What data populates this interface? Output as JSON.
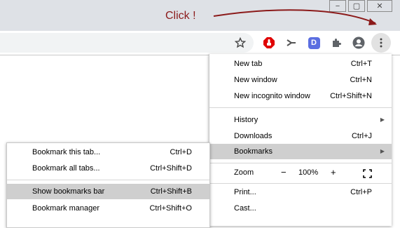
{
  "annotation": {
    "text": "Click !",
    "color": "#8b1a1a"
  },
  "window_buttons": {
    "minimize": "−",
    "maximize": "▢",
    "close": "✕"
  },
  "toolbar": {
    "icons": [
      "star-icon",
      "adblock-icon",
      "extension-share-icon",
      "d-extension-icon",
      "puzzle-extensions-icon",
      "profile-avatar-icon",
      "kebab-menu-icon"
    ],
    "d_extension_letter": "D",
    "d_extension_color": "#5b6ee1",
    "adblock_color": "#e00000"
  },
  "main_menu": {
    "items": [
      {
        "label": "New tab",
        "shortcut": "Ctrl+T"
      },
      {
        "label": "New window",
        "shortcut": "Ctrl+N"
      },
      {
        "label": "New incognito window",
        "shortcut": "Ctrl+Shift+N"
      },
      {
        "label": "History",
        "shortcut": ""
      },
      {
        "label": "Downloads",
        "shortcut": "Ctrl+J"
      },
      {
        "label": "Bookmarks",
        "shortcut": ""
      },
      {
        "label": "Print...",
        "shortcut": "Ctrl+P"
      },
      {
        "label": "Cast...",
        "shortcut": ""
      }
    ],
    "zoom": {
      "label": "Zoom",
      "minus": "−",
      "value": "100%",
      "plus": "+"
    }
  },
  "bookmarks_submenu": {
    "items": [
      {
        "label": "Bookmark this tab...",
        "shortcut": "Ctrl+D"
      },
      {
        "label": "Bookmark all tabs...",
        "shortcut": "Ctrl+Shift+D"
      },
      {
        "label": "Show bookmarks bar",
        "shortcut": "Ctrl+Shift+B"
      },
      {
        "label": "Bookmark manager",
        "shortcut": "Ctrl+Shift+O"
      }
    ]
  }
}
